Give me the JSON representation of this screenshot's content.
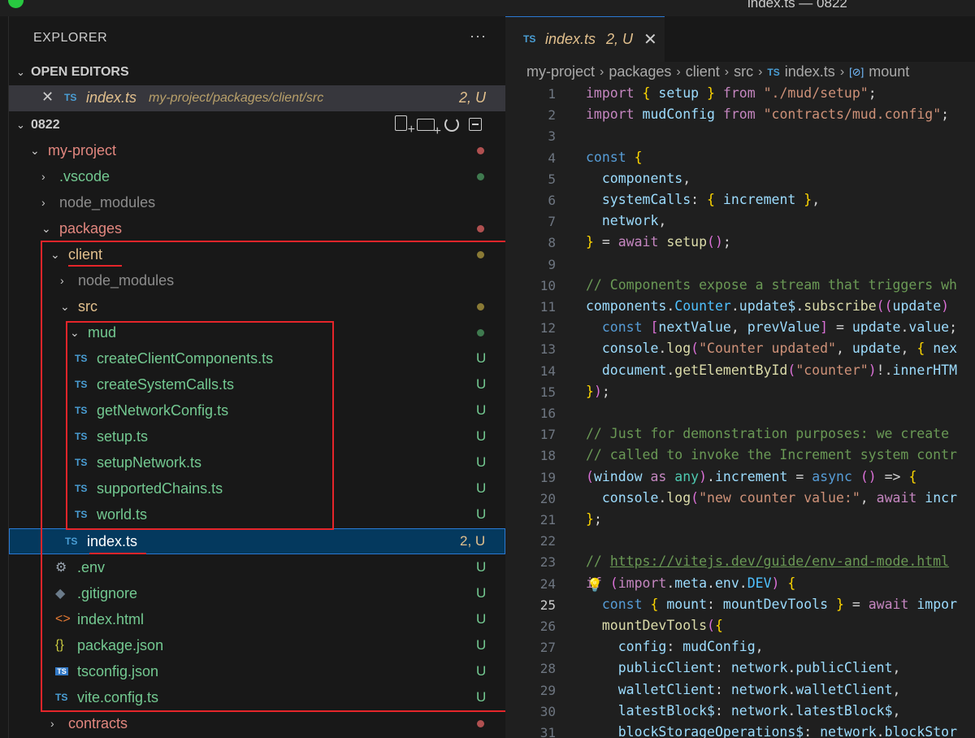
{
  "window": {
    "title": "index.ts — 0822"
  },
  "explorer": {
    "title": "EXPLORER",
    "more": "···",
    "open_editors": {
      "heading": "OPEN EDITORS",
      "items": [
        {
          "type_badge": "TS",
          "name": "index.ts",
          "path": "my-project/packages/client/src",
          "status": "2, U"
        }
      ]
    },
    "workspace": {
      "name": "0822",
      "tree": [
        {
          "id": "my-project",
          "label": "my-project",
          "chevron": "⌄",
          "icon": "",
          "status": "",
          "dot": "#b05050"
        },
        {
          "id": "vscode",
          "label": ".vscode",
          "chevron": "›",
          "icon": "",
          "status": "",
          "dot": "#3f7a4f"
        },
        {
          "id": "node-modules-root",
          "label": "node_modules",
          "chevron": "›",
          "icon": "",
          "status": "",
          "dot": ""
        },
        {
          "id": "packages",
          "label": "packages",
          "chevron": "⌄",
          "icon": "",
          "status": "",
          "dot": "#b05050"
        },
        {
          "id": "client",
          "label": "client",
          "chevron": "⌄",
          "icon": "",
          "status": "",
          "dot": "#8a7a35"
        },
        {
          "id": "node-modules-client",
          "label": "node_modules",
          "chevron": "›",
          "icon": "",
          "status": "",
          "dot": ""
        },
        {
          "id": "src",
          "label": "src",
          "chevron": "⌄",
          "icon": "",
          "status": "",
          "dot": "#8a7a35"
        },
        {
          "id": "mud",
          "label": "mud",
          "chevron": "⌄",
          "icon": "",
          "status": "",
          "dot": "#3f7a4f"
        },
        {
          "id": "createClientComponents",
          "label": "createClientComponents.ts",
          "chevron": "",
          "icon": "TS",
          "status": "U",
          "dot": ""
        },
        {
          "id": "createSystemCalls",
          "label": "createSystemCalls.ts",
          "chevron": "",
          "icon": "TS",
          "status": "U",
          "dot": ""
        },
        {
          "id": "getNetworkConfig",
          "label": "getNetworkConfig.ts",
          "chevron": "",
          "icon": "TS",
          "status": "U",
          "dot": ""
        },
        {
          "id": "setup",
          "label": "setup.ts",
          "chevron": "",
          "icon": "TS",
          "status": "U",
          "dot": ""
        },
        {
          "id": "setupNetwork",
          "label": "setupNetwork.ts",
          "chevron": "",
          "icon": "TS",
          "status": "U",
          "dot": ""
        },
        {
          "id": "supportedChains",
          "label": "supportedChains.ts",
          "chevron": "",
          "icon": "TS",
          "status": "U",
          "dot": ""
        },
        {
          "id": "world",
          "label": "world.ts",
          "chevron": "",
          "icon": "TS",
          "status": "U",
          "dot": ""
        },
        {
          "id": "index-ts",
          "label": "index.ts",
          "chevron": "",
          "icon": "TS",
          "status": "2, U",
          "dot": ""
        },
        {
          "id": "env",
          "label": ".env",
          "chevron": "",
          "icon": "⚙",
          "status": "U",
          "dot": ""
        },
        {
          "id": "gitignore",
          "label": ".gitignore",
          "chevron": "",
          "icon": "◆",
          "status": "U",
          "dot": ""
        },
        {
          "id": "index-html",
          "label": "index.html",
          "chevron": "",
          "icon": "<>",
          "status": "U",
          "dot": ""
        },
        {
          "id": "package-json",
          "label": "package.json",
          "chevron": "",
          "icon": "{}",
          "status": "U",
          "dot": ""
        },
        {
          "id": "tsconfig-json",
          "label": "tsconfig.json",
          "chevron": "",
          "icon": "TS",
          "status": "U",
          "dot": ""
        },
        {
          "id": "vite-config",
          "label": "vite.config.ts",
          "chevron": "",
          "icon": "TS",
          "status": "U",
          "dot": ""
        },
        {
          "id": "contracts",
          "label": "contracts",
          "chevron": "›",
          "icon": "",
          "status": "",
          "dot": "#b05050"
        }
      ]
    }
  },
  "editor": {
    "tab": {
      "type_badge": "TS",
      "name": "index.ts",
      "status": "2, U",
      "close": "✕"
    },
    "breadcrumb": [
      "my-project",
      "packages",
      "client",
      "src",
      "index.ts",
      "mount"
    ],
    "breadcrumb_ts": "TS",
    "breadcrumb_sym": "[⊘]",
    "active_line": 25,
    "line_numbers": [
      "1",
      "2",
      "3",
      "4",
      "5",
      "6",
      "7",
      "8",
      "9",
      "10",
      "11",
      "12",
      "13",
      "14",
      "15",
      "16",
      "17",
      "18",
      "19",
      "20",
      "21",
      "22",
      "23",
      "24",
      "25",
      "26",
      "27",
      "28",
      "29",
      "30",
      "31"
    ],
    "code": [
      "import { setup } from \"./mud/setup\";",
      "import mudConfig from \"contracts/mud.config\";",
      "",
      "const {",
      "  components,",
      "  systemCalls: { increment },",
      "  network,",
      "} = await setup();",
      "",
      "// Components expose a stream that triggers wh",
      "components.Counter.update$.subscribe((update)",
      "  const [nextValue, prevValue] = update.value;",
      "  console.log(\"Counter updated\", update, { nex",
      "  document.getElementById(\"counter\")!.innerHTM",
      "});",
      "",
      "// Just for demonstration purposes: we create",
      "// called to invoke the Increment system contr",
      "(window as any).increment = async () => {",
      "  console.log(\"new counter value:\", await incr",
      "};",
      "",
      "// https://vitejs.dev/guide/env-and-mode.html",
      "if (import.meta.env.DEV) {",
      "  const { mount: mountDevTools } = await impor",
      "  mountDevTools({",
      "    config: mudConfig,",
      "    publicClient: network.publicClient,",
      "    walletClient: network.walletClient,",
      "    latestBlock$: network.latestBlock$,",
      "    blockStorageOperations$: network.blockStor"
    ]
  },
  "colors": {
    "accent": "#2b79d3",
    "annotation": "#e5252a",
    "untracked": "#73c991",
    "modified": "#e2c08d"
  }
}
